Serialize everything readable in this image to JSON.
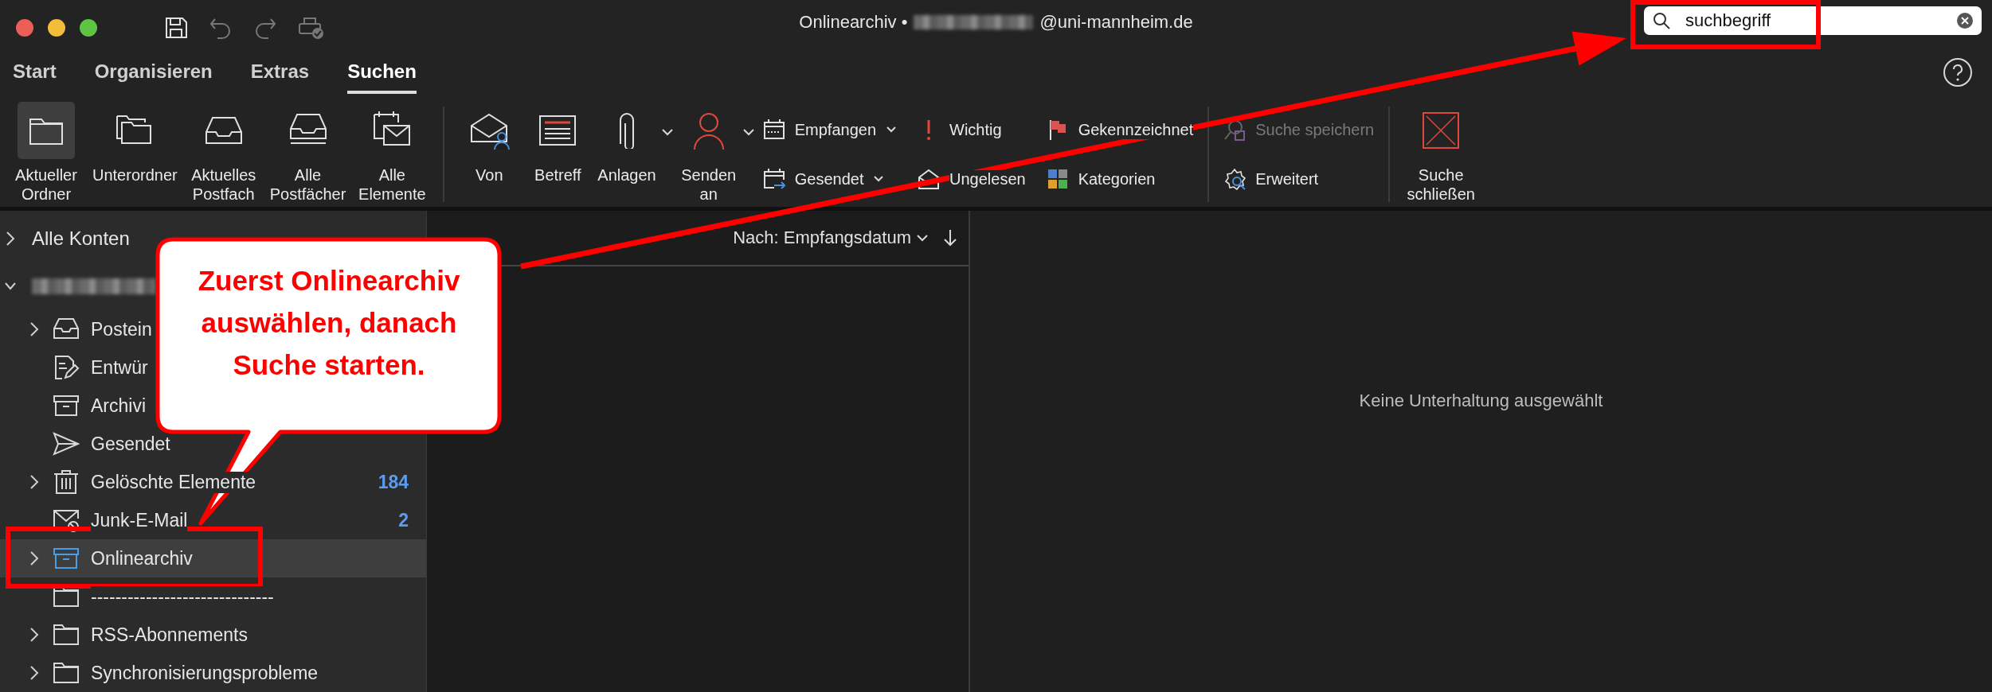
{
  "window": {
    "title_prefix": "Onlinearchiv •",
    "title_suffix": "@uni-mannheim.de"
  },
  "tabs": [
    {
      "label": "Start",
      "selected": false
    },
    {
      "label": "Organisieren",
      "selected": false
    },
    {
      "label": "Extras",
      "selected": false
    },
    {
      "label": "Suchen",
      "selected": true
    }
  ],
  "ribbon": {
    "scope": [
      {
        "label": "Aktueller\nOrdner",
        "selected": true
      },
      {
        "label": "Unterordner",
        "selected": false
      },
      {
        "label": "Aktuelles\nPostfach",
        "selected": false
      },
      {
        "label": "Alle\nPostfächer",
        "selected": false
      },
      {
        "label": "Alle\nElemente",
        "selected": false
      }
    ],
    "filters": [
      {
        "label": "Von"
      },
      {
        "label": "Betreff"
      },
      {
        "label": "Anlagen",
        "dropdown": true
      },
      {
        "label": "Senden\nan",
        "dropdown": true
      }
    ],
    "refine": [
      {
        "label": "Empfangen",
        "dropdown": true
      },
      {
        "label": "Gesendet",
        "dropdown": true
      },
      {
        "label": "Wichtig"
      },
      {
        "label": "Ungelesen"
      },
      {
        "label": "Gekennzeichnet"
      },
      {
        "label": "Kategorien"
      }
    ],
    "search_tools": [
      {
        "label": "Suche speichern",
        "disabled": true
      },
      {
        "label": "Erweitert",
        "disabled": false
      }
    ],
    "close": "Suche\nschließen"
  },
  "search": {
    "value": "suchbegriff"
  },
  "sidebar": {
    "accounts": [
      {
        "label": "Alle Konten",
        "expanded": false
      },
      {
        "expanded": true,
        "children": [
          {
            "label": "Postein",
            "kind": "inbox",
            "expanded": false,
            "selected": false
          },
          {
            "label": "Entwür",
            "kind": "drafts",
            "selected": false
          },
          {
            "label": "Archivi",
            "kind": "archive",
            "selected": false
          },
          {
            "label": "Gesendet",
            "kind": "sent",
            "selected": false
          },
          {
            "label": "Gelöschte Elemente",
            "kind": "trash",
            "expanded": false,
            "count": "184",
            "selected": false
          },
          {
            "label": "Junk-E-Mail",
            "kind": "junk",
            "count": "2",
            "selected": false
          },
          {
            "label": "Onlinearchiv",
            "kind": "archive",
            "expanded": false,
            "selected": true
          },
          {
            "label": "------------------------------",
            "kind": "folder",
            "selected": false
          },
          {
            "label": "RSS-Abonnements",
            "kind": "folder",
            "expanded": false,
            "selected": false
          },
          {
            "label": "Synchronisierungsprobleme",
            "kind": "folder",
            "expanded": false,
            "selected": false
          }
        ]
      }
    ]
  },
  "message_list": {
    "sort": "Nach: Empfangsdatum"
  },
  "reading_pane": {
    "empty_text": "Keine Unterhaltung ausgewählt"
  },
  "annotations": {
    "callout": "Zuerst Onlinearchiv\nauswählen, danach\nSuche starten."
  }
}
